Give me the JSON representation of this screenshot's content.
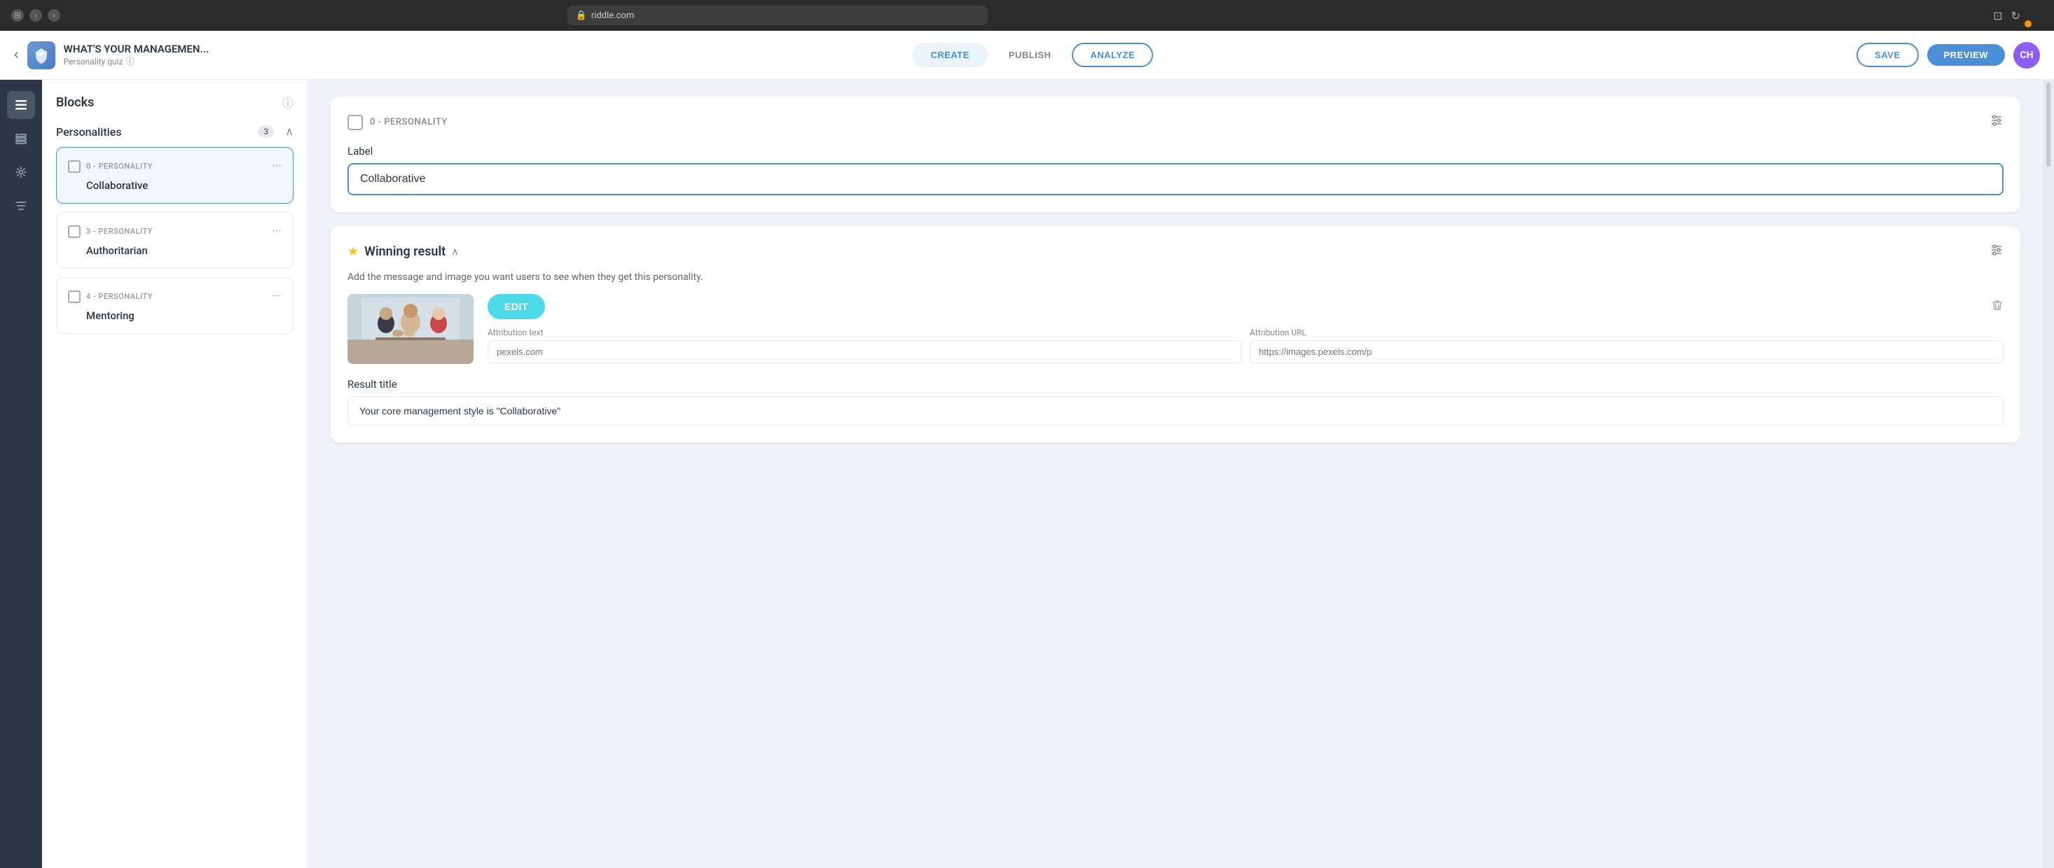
{
  "browser": {
    "url": "riddle.com",
    "lock_icon": "🔒"
  },
  "header": {
    "back_label": "‹",
    "logo_icon": "◈",
    "title": "WHAT'S YOUR MANAGEMEN...",
    "subtitle": "Personality quiz",
    "nav": {
      "create_label": "CREATE",
      "publish_label": "PUBLISH",
      "analyze_label": "ANALYZE"
    },
    "save_label": "SAVE",
    "preview_label": "PREVIEW",
    "avatar_initials": "CH"
  },
  "sidebar_icons": [
    {
      "name": "blocks-icon",
      "symbol": "☰",
      "active": true
    },
    {
      "name": "layers-icon",
      "symbol": "⊟",
      "active": false
    },
    {
      "name": "settings-icon",
      "symbol": "⚙",
      "active": false
    },
    {
      "name": "filter-icon",
      "symbol": "⫷",
      "active": false
    }
  ],
  "blocks_panel": {
    "title": "Blocks",
    "section": {
      "title": "Personalities",
      "count": "3",
      "cards": [
        {
          "type": "0 - PERSONALITY",
          "name": "Collaborative",
          "active": true
        },
        {
          "type": "3 - PERSONALITY",
          "name": "Authoritarian",
          "active": false
        },
        {
          "type": "4 - PERSONALITY",
          "name": "Mentoring",
          "active": false
        }
      ]
    }
  },
  "content": {
    "personality_block": {
      "label_tag": "0 - PERSONALITY",
      "field_label": "Label",
      "field_value": "Collaborative"
    },
    "winning_result": {
      "title": "Winning result",
      "description": "Add the message and image you want users to see when they get this personality.",
      "edit_label": "EDIT",
      "attribution_text_label": "Attribution text",
      "attribution_text_placeholder": "pexels.com",
      "attribution_url_label": "Attribution URL",
      "attribution_url_placeholder": "https://images.pexels.com/p",
      "result_title_label": "Result title",
      "result_title_value": "Your core management style is \"Collaborative\""
    }
  }
}
